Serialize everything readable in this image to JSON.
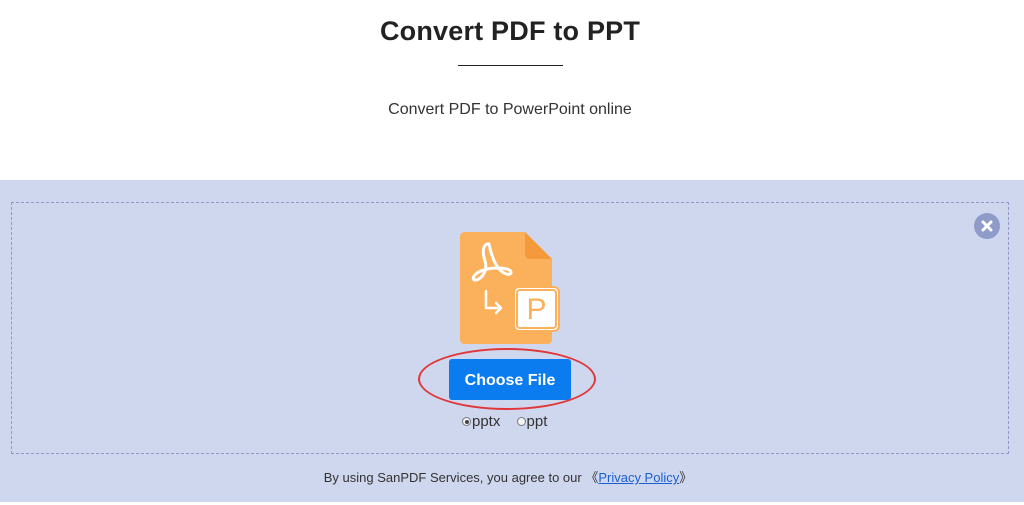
{
  "header": {
    "title": "Convert PDF to PPT",
    "subtitle": "Convert PDF to PowerPoint online"
  },
  "uploader": {
    "close_icon": "close-icon",
    "file_icon": "pdf-to-ppt-file-icon",
    "file_icon_badge": "P",
    "choose_label": "Choose File",
    "formats": [
      {
        "label": "pptx",
        "selected": true
      },
      {
        "label": "ppt",
        "selected": false
      }
    ]
  },
  "footer": {
    "agree_prefix": "By using SanPDF Services, you agree to our ",
    "bracket_open": "《",
    "privacy_link": "Privacy Policy",
    "bracket_close": "》"
  },
  "colors": {
    "band_background": "#cfd7ee",
    "primary_button": "#0a7cf0",
    "file_icon": "#fbb05c",
    "annotation_ring": "#e0383a"
  }
}
